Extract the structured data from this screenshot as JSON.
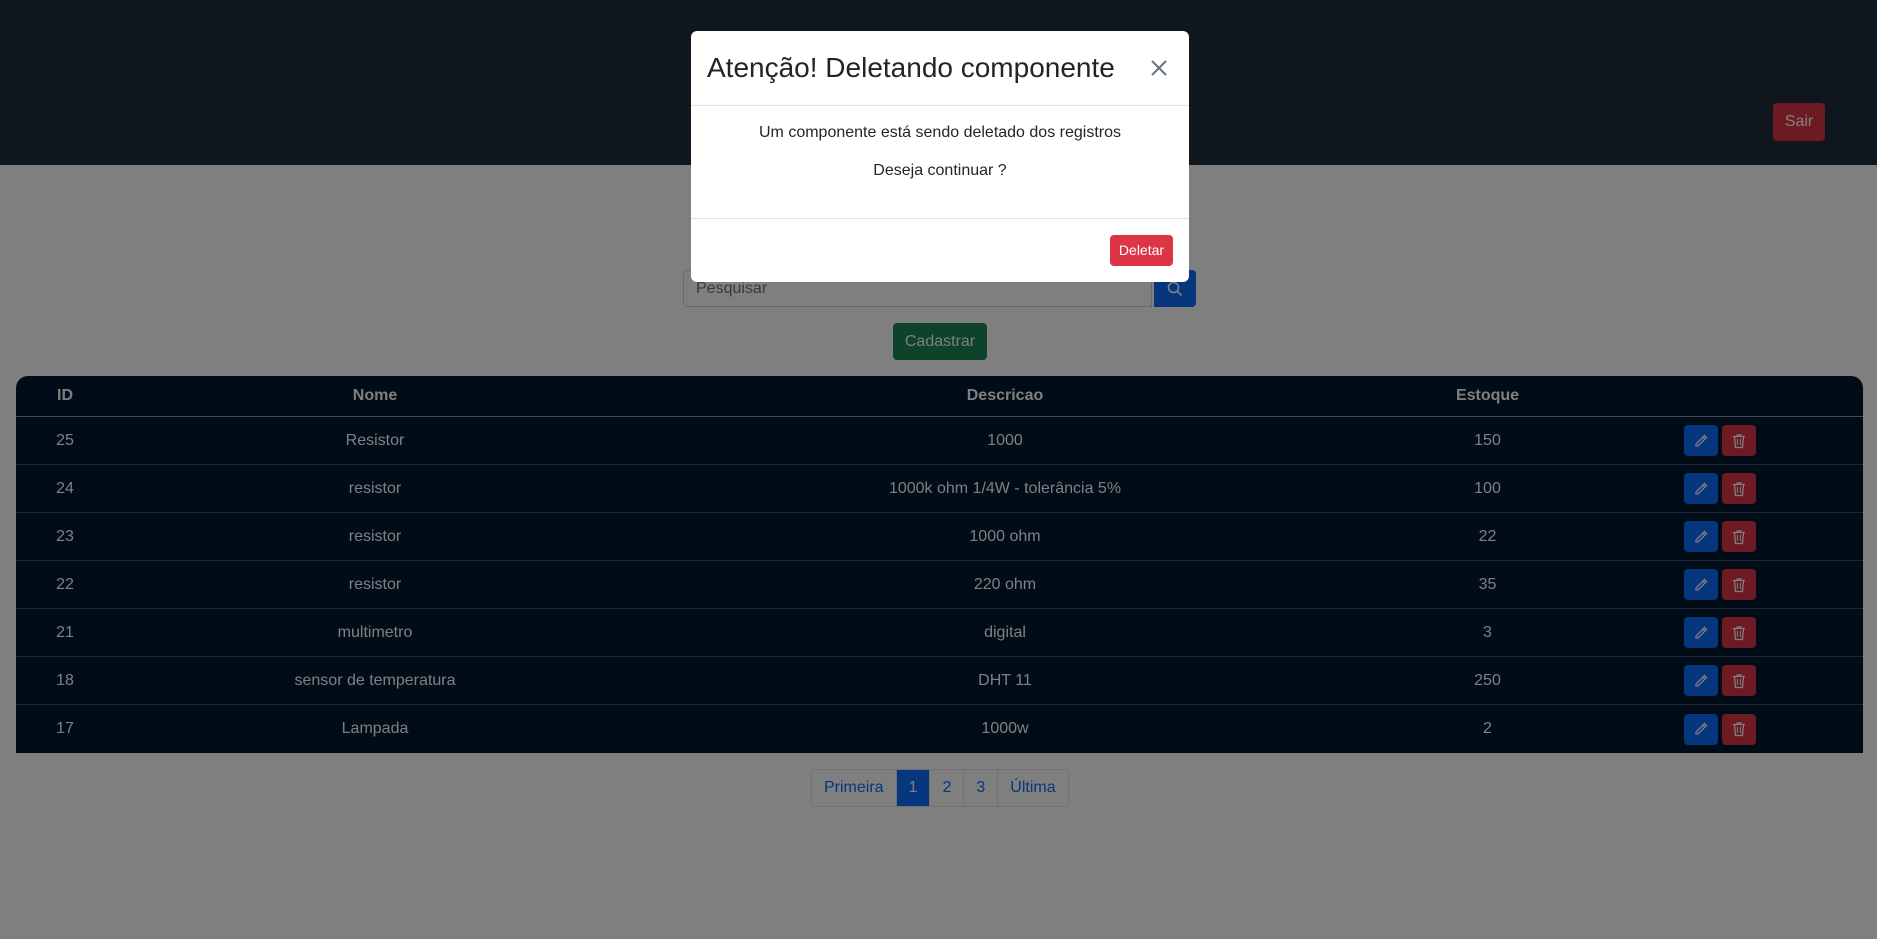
{
  "header": {
    "logout_label": "Sair"
  },
  "search": {
    "placeholder": "Pesquisar"
  },
  "register_label": "Cadastrar",
  "table": {
    "headers": {
      "id": "ID",
      "nome": "Nome",
      "descricao": "Descricao",
      "estoque": "Estoque"
    },
    "rows": [
      {
        "id": "25",
        "nome": "Resistor",
        "descricao": "1000",
        "estoque": "150"
      },
      {
        "id": "24",
        "nome": "resistor",
        "descricao": "1000k ohm 1/4W - tolerância 5%",
        "estoque": "100"
      },
      {
        "id": "23",
        "nome": "resistor",
        "descricao": "1000 ohm",
        "estoque": "22"
      },
      {
        "id": "22",
        "nome": "resistor",
        "descricao": "220 ohm",
        "estoque": "35"
      },
      {
        "id": "21",
        "nome": "multimetro",
        "descricao": "digital",
        "estoque": "3"
      },
      {
        "id": "18",
        "nome": "sensor de temperatura",
        "descricao": "DHT 11",
        "estoque": "250"
      },
      {
        "id": "17",
        "nome": "Lampada",
        "descricao": "1000w",
        "estoque": "2"
      }
    ],
    "row_icons": {
      "edit": "pencil-icon",
      "delete": "trash-icon"
    }
  },
  "pagination": {
    "items": [
      "Primeira",
      "1",
      "2",
      "3",
      "Última"
    ],
    "active": "1"
  },
  "modal": {
    "title": "Atenção! Deletando componente",
    "line1": "Um componente está sendo deletado dos registros",
    "line2": "Deseja continuar ?",
    "delete_label": "Deletar"
  },
  "colors": {
    "header_bg": "#212c3d",
    "table_bg": "#01182f",
    "primary": "#0d6efd",
    "danger": "#dc3545",
    "success": "#198754"
  }
}
